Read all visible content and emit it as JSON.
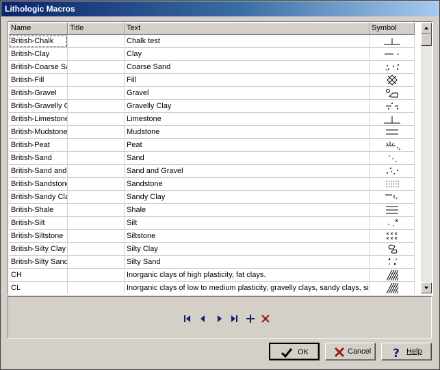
{
  "window": {
    "title": "Lithologic Macros"
  },
  "columns": [
    "Name",
    "Title",
    "Text",
    "Symbol"
  ],
  "rows": [
    {
      "name": "British-Chalk",
      "title": "",
      "text": "Chalk test",
      "symbol": "chalk-symbol-icon"
    },
    {
      "name": "British-Clay",
      "title": "",
      "text": "Clay",
      "symbol": "clay-symbol-icon"
    },
    {
      "name": "British-Coarse Sa",
      "title": "",
      "text": "Coarse Sand",
      "symbol": "coarse-sand-symbol-icon"
    },
    {
      "name": "British-Fill",
      "title": "",
      "text": "Fill",
      "symbol": "fill-symbol-icon"
    },
    {
      "name": "British-Gravel",
      "title": "",
      "text": "Gravel",
      "symbol": "gravel-symbol-icon"
    },
    {
      "name": "British-Gravelly C",
      "title": "",
      "text": "Gravelly Clay",
      "symbol": "gravelly-clay-symbol-icon"
    },
    {
      "name": "British-Limestone",
      "title": "",
      "text": "Limestone",
      "symbol": "limestone-symbol-icon"
    },
    {
      "name": "British-Mudstone",
      "title": "",
      "text": "Mudstone",
      "symbol": "mudstone-symbol-icon"
    },
    {
      "name": "British-Peat",
      "title": "",
      "text": "Peat",
      "symbol": "peat-symbol-icon"
    },
    {
      "name": "British-Sand",
      "title": "",
      "text": "Sand",
      "symbol": "sand-symbol-icon"
    },
    {
      "name": "British-Sand and G",
      "title": "",
      "text": "Sand and Gravel",
      "symbol": "sand-gravel-symbol-icon"
    },
    {
      "name": "British-Sandstone",
      "title": "",
      "text": "Sandstone",
      "symbol": "sandstone-symbol-icon"
    },
    {
      "name": "British-Sandy Clay",
      "title": "",
      "text": "Sandy Clay",
      "symbol": "sandy-clay-symbol-icon"
    },
    {
      "name": "British-Shale",
      "title": "",
      "text": "Shale",
      "symbol": "shale-symbol-icon"
    },
    {
      "name": "British-Silt",
      "title": "",
      "text": "Silt",
      "symbol": "silt-symbol-icon"
    },
    {
      "name": "British-Siltstone",
      "title": "",
      "text": "Siltstone",
      "symbol": "siltstone-symbol-icon"
    },
    {
      "name": "British-Silty Clay",
      "title": "",
      "text": "Silty Clay",
      "symbol": "silty-clay-symbol-icon"
    },
    {
      "name": "British-Silty Sand",
      "title": "",
      "text": "Silty Sand",
      "symbol": "silty-sand-symbol-icon"
    },
    {
      "name": "CH",
      "title": "",
      "text": "Inorganic clays of high plasticity, fat clays.",
      "symbol": "hatch-symbol-icon"
    },
    {
      "name": "CL",
      "title": "",
      "text": "Inorganic clays of low to medium plasticity, gravelly clays, sandy clays, silty clays, lean clays.",
      "symbol": "hatch-symbol-icon"
    }
  ],
  "navigation": {
    "icons": [
      "first-record-icon",
      "previous-record-icon",
      "next-record-icon",
      "last-record-icon",
      "add-record-icon",
      "delete-record-icon"
    ],
    "accent": "#0a246a",
    "delete_color": "#a01818"
  },
  "buttons": {
    "ok": "OK",
    "cancel": "Cancel",
    "help": "Help"
  }
}
